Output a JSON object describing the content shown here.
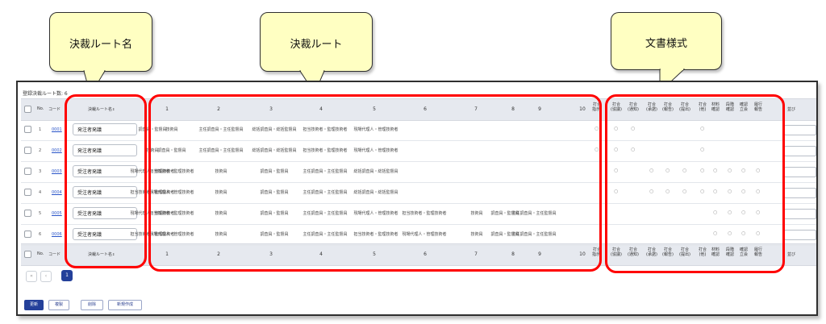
{
  "callouts": {
    "route_name": "決裁ルート名",
    "route": "決裁ルート",
    "doc_style": "文書様式"
  },
  "list": {
    "count_label": "登録決裁ルート数: 6",
    "header": {
      "no": "No.",
      "code": "コード",
      "route_name": "決裁ルート名",
      "route_cols": [
        "1",
        "2",
        "3",
        "4",
        "5",
        "6",
        "7",
        "8",
        "9",
        "10"
      ],
      "doc_cols": [
        [
          "打合",
          "指示)"
        ],
        [
          "打合",
          "(協議)"
        ],
        [
          "打合",
          "(通知)"
        ],
        [
          "打合",
          "(承諾)"
        ],
        [
          "打合",
          "(報告)"
        ],
        [
          "打合",
          "(提出)"
        ],
        [
          "打合",
          "(他)"
        ],
        [
          "材料",
          "確認"
        ],
        [
          "段階",
          "確認"
        ],
        [
          "確認",
          "立会"
        ],
        [
          "履行",
          "報告"
        ]
      ],
      "sort": "並び"
    },
    "rows": [
      {
        "no": "1",
        "code": "0001",
        "name": "発注者発議",
        "route": [
          "調査員・監督員",
          "技術員",
          "主任調査員・主任監督員",
          "総括調査員・総括監督員",
          "担当技術者・監理技術者",
          "現場代理人・管理技術者",
          "",
          "",
          "",
          ""
        ],
        "docs": [
          true,
          true,
          true,
          false,
          false,
          false,
          true,
          false,
          false,
          false,
          false
        ]
      },
      {
        "no": "2",
        "code": "0002",
        "name": "発注者発議",
        "route": [
          "技術員",
          "調査員・監督員",
          "主任調査員・主任監督員",
          "総括調査員・総括監督員",
          "担当技術者・監理技術者",
          "現場代理人・管理技術者",
          "",
          "",
          "",
          ""
        ],
        "docs": [
          true,
          true,
          true,
          false,
          false,
          false,
          true,
          false,
          false,
          false,
          false
        ]
      },
      {
        "no": "3",
        "code": "0003",
        "name": "受注者発議",
        "route": [
          "現場代理人・管理技術者",
          "担当技術者・監理技術者",
          "技術員",
          "調査員・監督員",
          "主任調査員・主任監督員",
          "総括調査員・総括監督員",
          "",
          "",
          "",
          ""
        ],
        "docs": [
          false,
          true,
          false,
          true,
          true,
          true,
          true,
          true,
          true,
          true,
          true
        ]
      },
      {
        "no": "4",
        "code": "0004",
        "name": "受注者発議",
        "route": [
          "担当技術者・監理技術者",
          "現場代理人・管理技術者",
          "技術員",
          "調査員・監督員",
          "主任調査員・主任監督員",
          "総括調査員・総括監督員",
          "",
          "",
          "",
          ""
        ],
        "docs": [
          false,
          true,
          false,
          true,
          true,
          true,
          true,
          true,
          true,
          true,
          true
        ]
      },
      {
        "no": "5",
        "code": "0005",
        "name": "受注者発議",
        "route": [
          "現場代理人・管理技術者",
          "担当技術者・監理技術者",
          "技術員",
          "調査員・監督員",
          "主任調査員・主任監督員",
          "現場代理人・管理技術者",
          "担当技術者・監理技術者",
          "技術員",
          "調査員・監督員",
          "主任調査員・主任監督員"
        ],
        "docs": [
          false,
          false,
          false,
          false,
          false,
          false,
          false,
          true,
          true,
          true,
          true
        ]
      },
      {
        "no": "6",
        "code": "0006",
        "name": "受注者発議",
        "route": [
          "担当技術者・監理技術者",
          "現場代理人・管理技術者",
          "技術員",
          "調査員・監督員",
          "主任調査員・主任監督員",
          "担当技術者・監理技術者",
          "現場代理人・管理技術者",
          "技術員",
          "調査員・監督員",
          "主任調査員・主任監督員"
        ],
        "docs": [
          false,
          false,
          false,
          false,
          false,
          false,
          false,
          true,
          true,
          true,
          true
        ]
      }
    ],
    "circle_glyph": "○",
    "sort_glyph": "⇕"
  },
  "pagination": {
    "prev": "«",
    "prev_single": "‹",
    "current": "1"
  },
  "actions": {
    "update": "更新",
    "copy": "複製",
    "delete": "削除",
    "create": "新規作成"
  },
  "colors": {
    "highlight": "#ff0000",
    "callout_bg": "#ffffc2",
    "primary": "#24409a",
    "link": "#2a55c9"
  }
}
